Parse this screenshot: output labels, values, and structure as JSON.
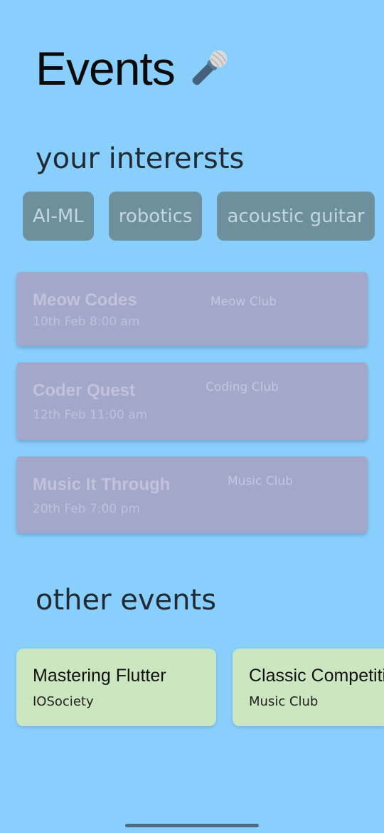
{
  "header": {
    "title": "Events",
    "title_icon": "microphone-icon"
  },
  "interests": {
    "heading": "your intererst s",
    "chips": [
      "AI-ML",
      "robotics",
      "acoustic guitar"
    ]
  },
  "your_events": [
    {
      "name": "Meow Codes",
      "date": "10th Feb 8:00 am",
      "club": "Meow Club"
    },
    {
      "name": "Coder Quest",
      "date": "12th Feb 11:00 am",
      "club": "Coding Club"
    },
    {
      "name": "Music It Through",
      "date": "20th Feb 7:00 pm",
      "club": "Music Club"
    }
  ],
  "other": {
    "heading": "other events",
    "events": [
      {
        "name": "Mastering Flutter",
        "club": "IOSociety"
      },
      {
        "name": "Classic Competition",
        "club": "Music Club"
      }
    ]
  },
  "colors": {
    "background": "#89cffd",
    "chip": "#6e8f9c",
    "event_card": "#a3a8cb",
    "other_card": "#cce6c0"
  }
}
